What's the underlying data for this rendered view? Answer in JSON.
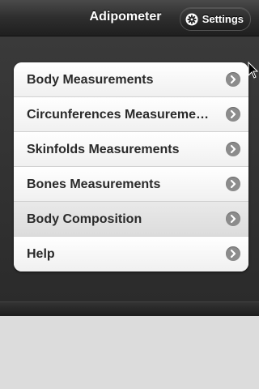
{
  "header": {
    "title": "Adipometer",
    "settings_label": "Settings",
    "settings_icon": "gear-icon"
  },
  "menu": {
    "items": [
      {
        "label": "Body Measurements"
      },
      {
        "label": "Circunferences Measurements"
      },
      {
        "label": "Skinfolds Measurements"
      },
      {
        "label": "Bones Measurements"
      },
      {
        "label": "Body Composition"
      },
      {
        "label": "Help"
      }
    ],
    "arrow_icon": "chevron-right-circle-icon"
  },
  "colors": {
    "header_bg": "#2e2e2e",
    "content_bg": "#333333",
    "list_bg": "#f6f6f6",
    "arrow_circle": "#8c8c8c",
    "bottom_bg": "#dcdcdc"
  }
}
